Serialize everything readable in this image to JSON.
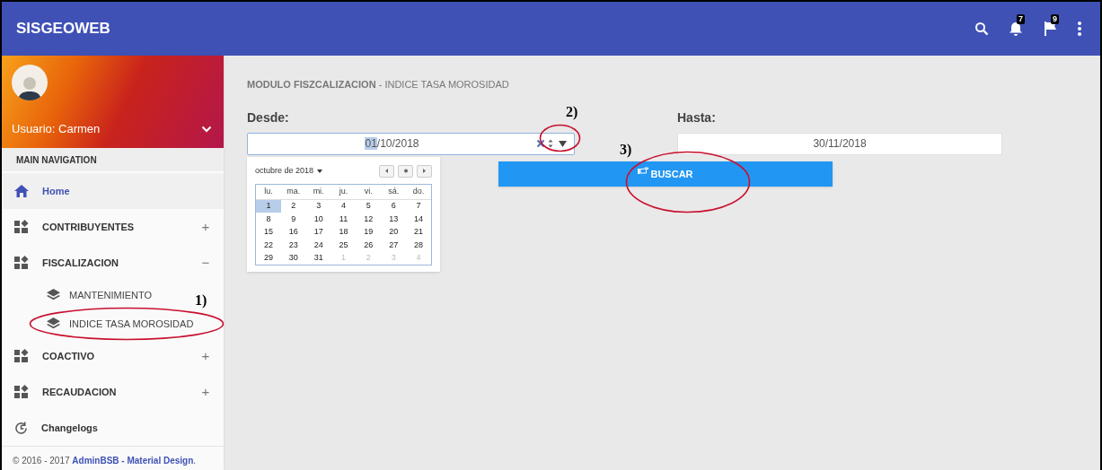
{
  "header": {
    "title": "SISGEOWEB",
    "actions": [
      {
        "kind": "search"
      },
      {
        "kind": "bell",
        "badge": "7"
      },
      {
        "kind": "flag",
        "badge": "9"
      },
      {
        "kind": "more"
      }
    ]
  },
  "sidebar": {
    "user": "Usuario: Carmen",
    "nav_header": "MAIN NAVIGATION",
    "items": [
      {
        "kind": "home",
        "label": "Home",
        "selected": true
      },
      {
        "kind": "group",
        "label": "CONTRIBUYENTES",
        "toggle": "+",
        "selected": false
      },
      {
        "kind": "group",
        "label": "FISCALIZACION",
        "toggle": "−",
        "selected": false,
        "children": [
          {
            "label": "MANTENIMIENTO",
            "selected": false
          },
          {
            "label": "INDICE TASA MOROSIDAD",
            "selected": false
          }
        ]
      },
      {
        "kind": "group",
        "label": "COACTIVO",
        "toggle": "+",
        "selected": false
      },
      {
        "kind": "group",
        "label": "RECAUDACION",
        "toggle": "+",
        "selected": false
      },
      {
        "kind": "history",
        "label": "Changelogs",
        "selected": false
      }
    ],
    "footer": {
      "text": "© 2016 - 2017",
      "link": "AdminBSB - Material Design",
      "end": "."
    }
  },
  "main": {
    "breadcrumb": "**MODULO FISZCALIZACION** - INDICE TASA MOROSIDAD",
    "from": {
      "label": "Desde:",
      "value_parts": [
        {
          "text": "01",
          "selected": true
        },
        {
          "text": "/10/2018",
          "selected": false
        }
      ]
    },
    "datepicker": {
      "month": "octubre de 2018",
      "weekdays": [
        "lu.",
        "ma.",
        "mi.",
        "ju.",
        "vi.",
        "sá.",
        "do."
      ],
      "days": [
        {
          "day": "1",
          "selected": true,
          "outside": false
        },
        {
          "day": "2",
          "selected": false,
          "outside": false
        },
        {
          "day": "3",
          "selected": false,
          "outside": false
        },
        {
          "day": "4",
          "selected": false,
          "outside": false
        },
        {
          "day": "5",
          "selected": false,
          "outside": false
        },
        {
          "day": "6",
          "selected": false,
          "outside": false
        },
        {
          "day": "7",
          "selected": false,
          "outside": false
        },
        {
          "day": "8",
          "selected": false,
          "outside": false
        },
        {
          "day": "9",
          "selected": false,
          "outside": false
        },
        {
          "day": "10",
          "selected": false,
          "outside": false
        },
        {
          "day": "11",
          "selected": false,
          "outside": false
        },
        {
          "day": "12",
          "selected": false,
          "outside": false
        },
        {
          "day": "13",
          "selected": false,
          "outside": false
        },
        {
          "day": "14",
          "selected": false,
          "outside": false
        },
        {
          "day": "15",
          "selected": false,
          "outside": false
        },
        {
          "day": "16",
          "selected": false,
          "outside": false
        },
        {
          "day": "17",
          "selected": false,
          "outside": false
        },
        {
          "day": "18",
          "selected": false,
          "outside": false
        },
        {
          "day": "19",
          "selected": false,
          "outside": false
        },
        {
          "day": "20",
          "selected": false,
          "outside": false
        },
        {
          "day": "21",
          "selected": false,
          "outside": false
        },
        {
          "day": "22",
          "selected": false,
          "outside": false
        },
        {
          "day": "23",
          "selected": false,
          "outside": false
        },
        {
          "day": "24",
          "selected": false,
          "outside": false
        },
        {
          "day": "25",
          "selected": false,
          "outside": false
        },
        {
          "day": "26",
          "selected": false,
          "outside": false
        },
        {
          "day": "27",
          "selected": false,
          "outside": false
        },
        {
          "day": "28",
          "selected": false,
          "outside": false
        },
        {
          "day": "29",
          "selected": false,
          "outside": false
        },
        {
          "day": "30",
          "selected": false,
          "outside": false
        },
        {
          "day": "31",
          "selected": false,
          "outside": false
        },
        {
          "day": "1",
          "selected": false,
          "outside": true
        },
        {
          "day": "2",
          "selected": false,
          "outside": true
        },
        {
          "day": "3",
          "selected": false,
          "outside": true
        },
        {
          "day": "4",
          "selected": false,
          "outside": true
        }
      ]
    },
    "to": {
      "label": "Hasta:",
      "value": "30/11/2018"
    },
    "button": "BUSCAR"
  },
  "annotations": [
    {
      "label": "1)"
    },
    {
      "label": "2)"
    },
    {
      "label": "3)"
    }
  ]
}
